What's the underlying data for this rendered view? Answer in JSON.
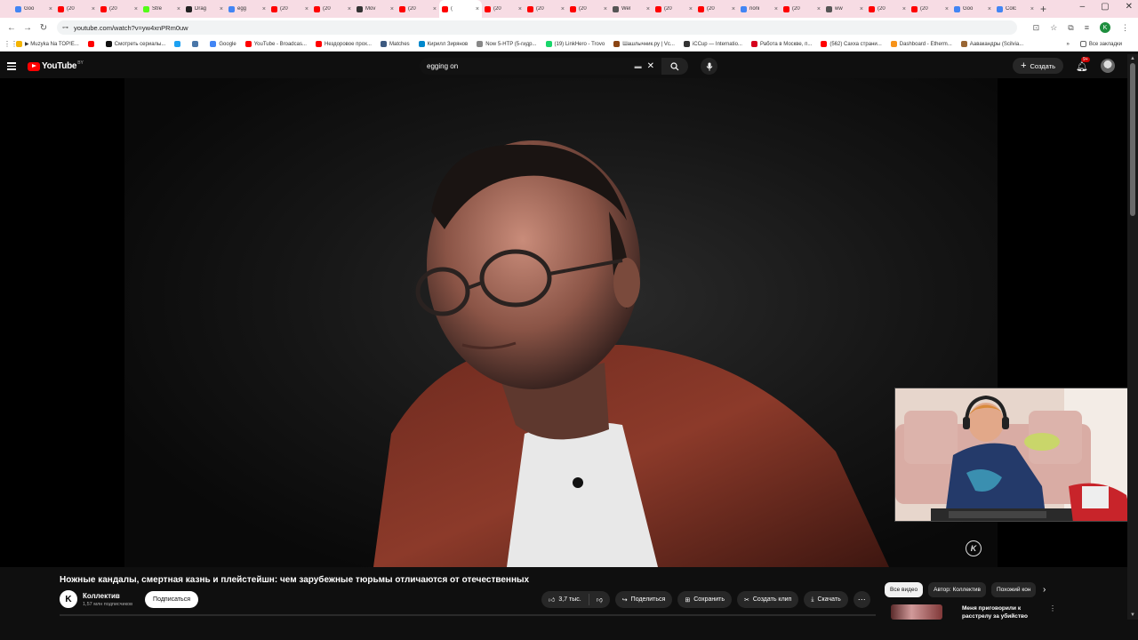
{
  "browser": {
    "tabs": [
      {
        "label": "Goo",
        "color": "#4285f4"
      },
      {
        "label": "(20",
        "color": "#ff0000"
      },
      {
        "label": "(20",
        "color": "#ff0000"
      },
      {
        "label": "Stre",
        "color": "#53fc18"
      },
      {
        "label": "Drag",
        "color": "#222222"
      },
      {
        "label": "egg",
        "color": "#4285f4"
      },
      {
        "label": "(20",
        "color": "#ff0000"
      },
      {
        "label": "(20",
        "color": "#ff0000"
      },
      {
        "label": "Mov",
        "color": "#333333"
      },
      {
        "label": "(20",
        "color": "#ff0000"
      },
      {
        "label": "(",
        "color": "#ff0000",
        "active": true
      },
      {
        "label": "(20",
        "color": "#ff0000"
      },
      {
        "label": "(20",
        "color": "#ff0000"
      },
      {
        "label": "(20",
        "color": "#ff0000"
      },
      {
        "label": "Wel",
        "color": "#555555"
      },
      {
        "label": "(20",
        "color": "#ff0000"
      },
      {
        "label": "(20",
        "color": "#ff0000"
      },
      {
        "label": "noni",
        "color": "#4285f4"
      },
      {
        "label": "(20",
        "color": "#ff0000"
      },
      {
        "label": "ww",
        "color": "#555555"
      },
      {
        "label": "(20",
        "color": "#ff0000"
      },
      {
        "label": "(20",
        "color": "#ff0000"
      },
      {
        "label": "Goo",
        "color": "#4285f4"
      },
      {
        "label": "Colc",
        "color": "#4285f4"
      }
    ],
    "url": "youtube.com/watch?v=yw4xnPRm0uw",
    "profile_initial": "K",
    "bookmarks": [
      {
        "label": "▶ Muzyka Na TOP!E...",
        "color": "#f4b400"
      },
      {
        "label": "",
        "color": "#ff0000"
      },
      {
        "label": "Смотреть сериалы...",
        "color": "#111111"
      },
      {
        "label": "",
        "color": "#1da1f2"
      },
      {
        "label": "",
        "color": "#4a76a8"
      },
      {
        "label": "Google",
        "color": "#4285f4"
      },
      {
        "label": "YouTube - Broadcas...",
        "color": "#ff0000"
      },
      {
        "label": "Нездоровое прох...",
        "color": "#ff0000"
      },
      {
        "label": "Matches",
        "color": "#3d5a80"
      },
      {
        "label": "Кирилл Зирянов",
        "color": "#0088cc"
      },
      {
        "label": "Now 5-HTP (5-гидр...",
        "color": "#888888"
      },
      {
        "label": "(19) LinkHero - Trovo",
        "color": "#19d66b"
      },
      {
        "label": "Шашлычник.ру | Vc...",
        "color": "#8b4513"
      },
      {
        "label": "iCCup — Internatio...",
        "color": "#333333"
      },
      {
        "label": "Работа в Москве, п...",
        "color": "#d6001c"
      },
      {
        "label": "(562) Сахха страни...",
        "color": "#ff0000"
      },
      {
        "label": "Dashboard - Etherm...",
        "color": "#f7931a"
      },
      {
        "label": "Аавакандры (Scilvia...",
        "color": "#996633"
      }
    ],
    "all_bookmarks": "Все закладки"
  },
  "youtube": {
    "logo_text": "YouTube",
    "region": "BY",
    "search_query": "egging on",
    "create_label": "Создать",
    "notif_count": "9+",
    "video": {
      "title": "Ножные кандалы, смертная казнь и плейстейшн: чем зарубежные тюрьмы отличаются от отечественных",
      "watermark": "K"
    },
    "channel": {
      "avatar_letter": "K",
      "name": "Коллектив",
      "subs": "1,57 млн подписчиков",
      "subscribe_label": "Подписаться"
    },
    "actions": {
      "likes": "3,7 тыс.",
      "share": "Поделиться",
      "save": "Сохранить",
      "clip": "Создать клип",
      "download": "Скачать"
    },
    "chips": [
      "Все видео",
      "Автор: Коллектив",
      "Похожий кон"
    ],
    "recommendation": {
      "title": "Меня приговорили к расстрелу за убийство"
    }
  }
}
